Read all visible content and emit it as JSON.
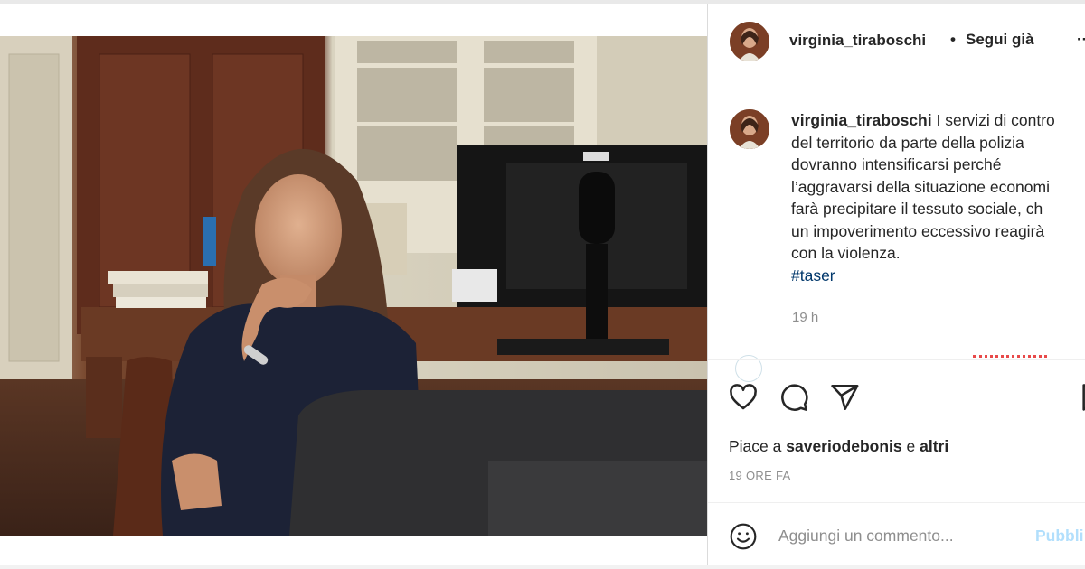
{
  "post": {
    "photo_alt": "post-photo",
    "author": {
      "username": "virginia_tiraboschi",
      "separator": "•",
      "follow_label": "Segui già",
      "more_icon": "more-horizontal-icon"
    },
    "caption": {
      "username": "virginia_tiraboschi",
      "lines": [
        "I servizi di contro",
        "del territorio da parte della polizia",
        "dovranno intensificarsi perché",
        "l’aggravarsi della situazione economi",
        "farà precipitare il tessuto sociale, ch",
        "un impoverimento eccessivo reagirà",
        "con la violenza."
      ],
      "hashtag": "#taser",
      "time": "19 h"
    },
    "actions": {
      "like_icon": "heart-icon",
      "comment_icon": "comment-icon",
      "share_icon": "paper-plane-icon",
      "save_icon": "bookmark-icon"
    },
    "likes": {
      "prefix": "Piace a",
      "user": "saveriodebonis",
      "conjunction": "e",
      "others": "altri"
    },
    "date": "19 ORE FA",
    "comment": {
      "emoji_icon": "emoji-icon",
      "placeholder": "Aggiungi un commento...",
      "publish_label": "Pubbli"
    }
  },
  "colors": {
    "text": "#262626",
    "secondary": "#8e8e8e",
    "link": "#00376b",
    "publish_disabled": "#b2dffc",
    "border": "#dbdbdb"
  }
}
